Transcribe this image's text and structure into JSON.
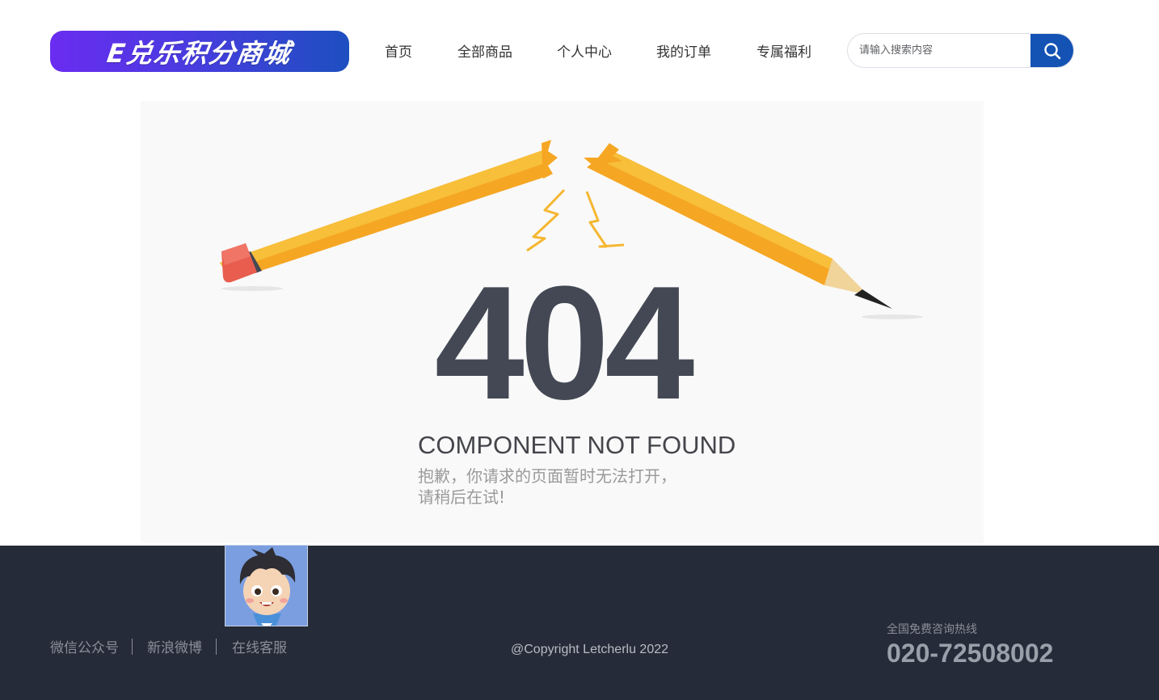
{
  "header": {
    "logo_text": "E兑乐积分商城",
    "nav": [
      {
        "label": "首页"
      },
      {
        "label": "全部商品"
      },
      {
        "label": "个人中心"
      },
      {
        "label": "我的订单"
      },
      {
        "label": "专属福利"
      }
    ],
    "search": {
      "placeholder": "请输入搜索内容",
      "value": ""
    }
  },
  "error_page": {
    "code": "404",
    "title": "COMPONENT NOT FOUND",
    "message_line1": "抱歉，你请求的页面暂时无法打开，",
    "message_line2": "请稍后在试!"
  },
  "footer": {
    "links": [
      {
        "label": "微信公众号"
      },
      {
        "label": "新浪微博"
      },
      {
        "label": "在线客服"
      }
    ],
    "copyright": "@Copyright Letcherlu 2022",
    "hotline_label": "全国免费咨询热线",
    "hotline_number": "020-72508002"
  },
  "colors": {
    "brand_blue": "#1452b4",
    "logo_gradient_start": "#6a2cf0",
    "footer_bg": "#252b38",
    "text_404": "#434854",
    "pencil_orange": "#f5a623"
  },
  "icons": {
    "search": "search-icon",
    "avatar": "cartoon-avatar"
  }
}
